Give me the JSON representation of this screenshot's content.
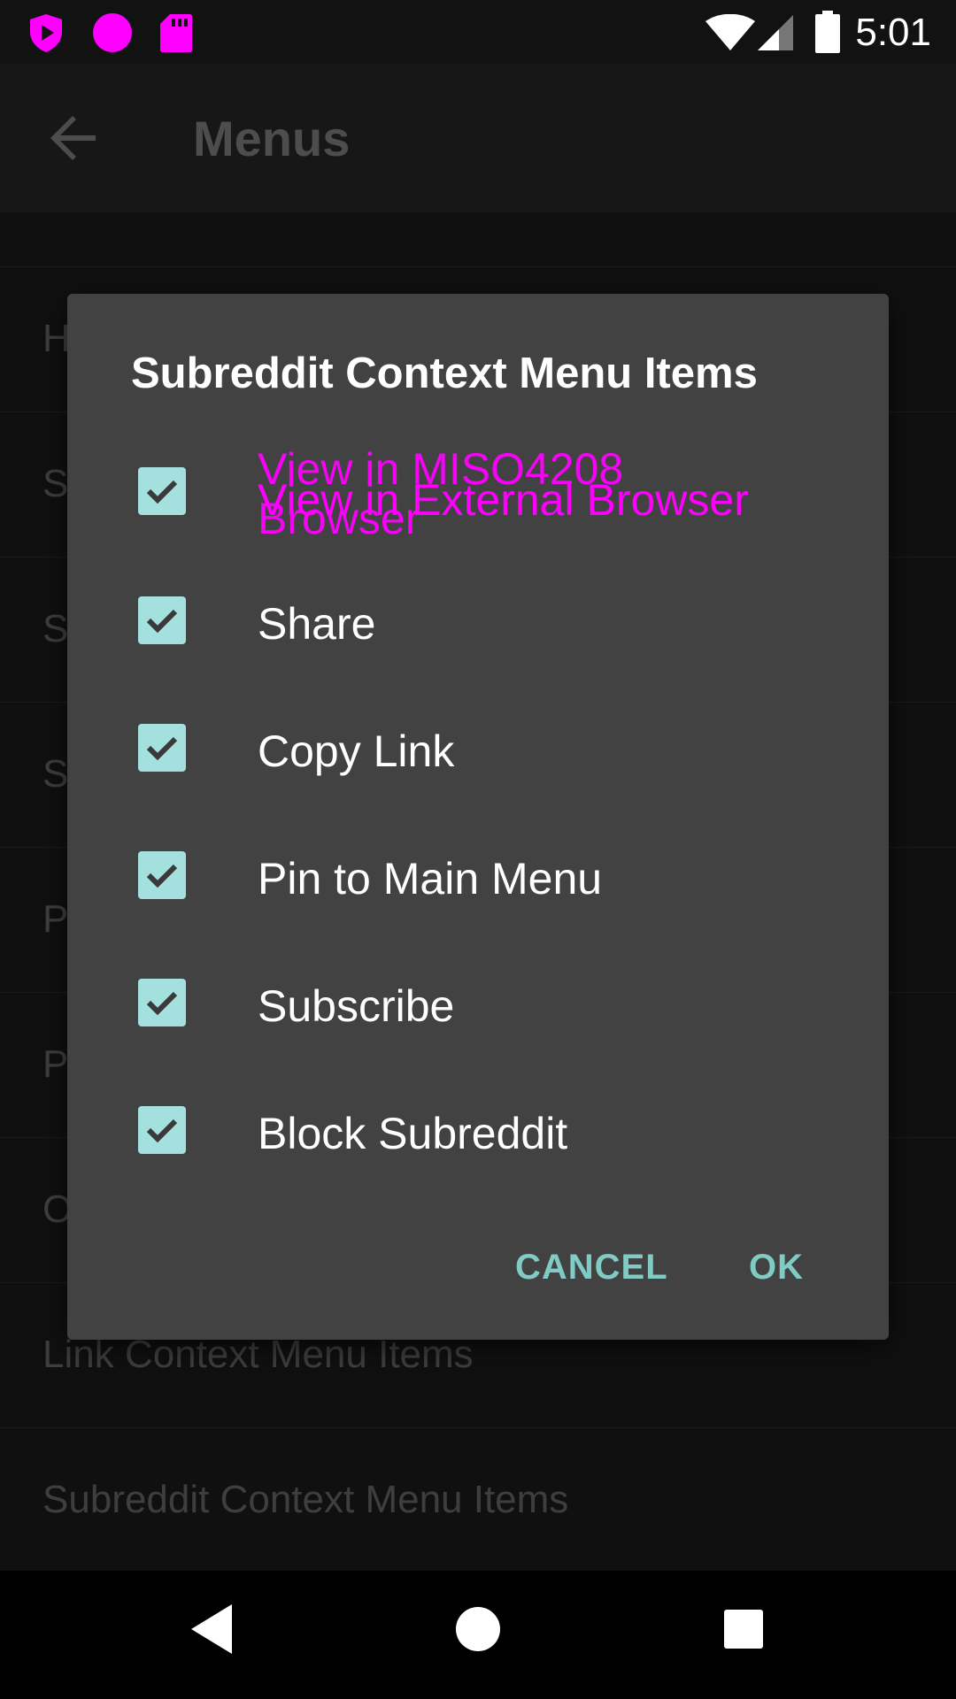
{
  "status_bar": {
    "time": "5:01",
    "icons": [
      "shield-play-icon",
      "circle-icon",
      "sd-card-icon",
      "wifi-icon",
      "signal-icon",
      "battery-icon"
    ],
    "accent_color": "#ff00ff"
  },
  "toolbar": {
    "title": "Menus",
    "back_icon": "arrow-back-icon"
  },
  "background_list": {
    "rows": [
      {
        "label": "H"
      },
      {
        "label": "S"
      },
      {
        "label": "S"
      },
      {
        "label": "S"
      },
      {
        "label": "P"
      },
      {
        "label": "P"
      },
      {
        "label": "O"
      },
      {
        "label": "Link Context Menu Items"
      },
      {
        "label": "Subreddit Context Menu Items"
      }
    ]
  },
  "dialog": {
    "title": "Subreddit Context Menu Items",
    "items": [
      {
        "label": "View in External Browser",
        "overlay_text": "View in MISO4208 Browser",
        "checked": true
      },
      {
        "label": "Share",
        "checked": true
      },
      {
        "label": "Copy Link",
        "checked": true
      },
      {
        "label": "Pin to Main Menu",
        "checked": true
      },
      {
        "label": "Subscribe",
        "checked": true
      },
      {
        "label": "Block Subreddit",
        "checked": true
      }
    ],
    "cancel_label": "CANCEL",
    "ok_label": "OK",
    "accent_color": "#80cbc4",
    "checkbox_color": "#a4e0dd"
  },
  "nav_bar": {
    "icons": [
      "back-triangle-icon",
      "home-circle-icon",
      "recents-square-icon"
    ]
  }
}
